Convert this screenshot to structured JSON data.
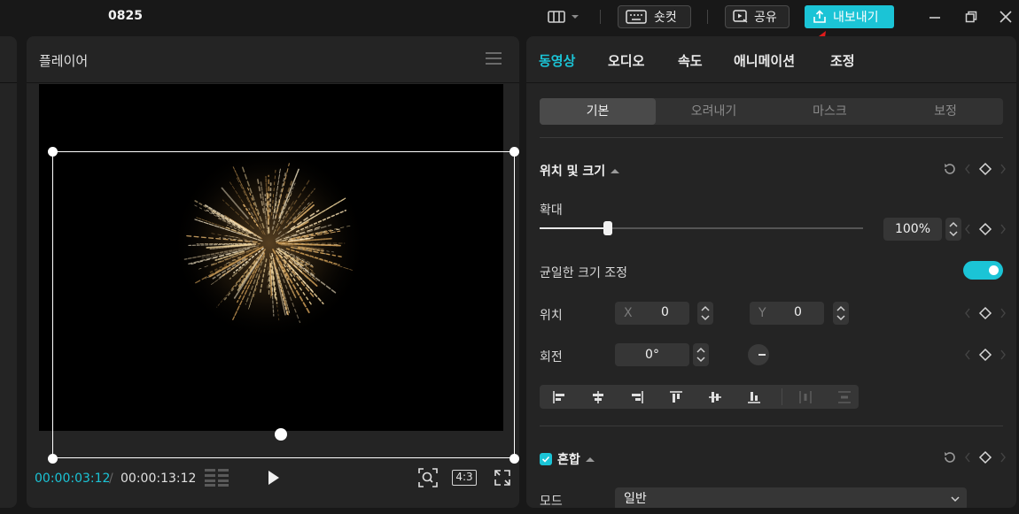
{
  "titlebar": {
    "project_name": "0825",
    "shortcut_label": "숏컷",
    "share_label": "공유",
    "export_label": "내보내기",
    "accent_color": "#1bc4d6"
  },
  "player": {
    "title": "플레이어",
    "current_time": "00:00:03:12",
    "separator": "/",
    "total_time": "00:00:13:12",
    "ratio_label": "4:3"
  },
  "inspector": {
    "tabs": [
      {
        "label": "동영상",
        "active": true
      },
      {
        "label": "오디오",
        "active": false
      },
      {
        "label": "속도",
        "active": false
      },
      {
        "label": "애니메이션",
        "active": false
      },
      {
        "label": "조정",
        "active": false
      }
    ],
    "subtabs": [
      {
        "label": "기본",
        "active": true
      },
      {
        "label": "오려내기",
        "active": false
      },
      {
        "label": "마스크",
        "active": false
      },
      {
        "label": "보정",
        "active": false
      }
    ],
    "position_size": {
      "title": "위치 및 크기",
      "scale_label": "확대",
      "scale_value": "100%",
      "scale_slider_fraction": 0.21,
      "uniform_scale_label": "균일한 크기 조정",
      "uniform_scale_on": true,
      "position_label": "위치",
      "x_label": "X",
      "x_value": "0",
      "y_label": "Y",
      "y_value": "0",
      "rotation_label": "회전",
      "rotation_value": "0°"
    },
    "blend": {
      "title": "혼합",
      "checked": true,
      "mode_label": "모드",
      "mode_value": "일반"
    }
  },
  "icons": [
    "layout-icon",
    "keyboard-icon",
    "share-video-icon",
    "upload-icon",
    "minimize-icon",
    "restore-icon",
    "close-icon",
    "menu-icon",
    "grid-icon",
    "play-icon",
    "zoom-fit-icon",
    "fullscreen-icon",
    "reset-icon",
    "keyframe-diamond-icon",
    "align-left-icon",
    "align-center-h-icon",
    "align-right-icon",
    "align-top-icon",
    "align-center-v-icon",
    "align-bottom-icon",
    "distribute-h-icon",
    "distribute-v-icon",
    "checkbox-icon",
    "chevron-down-icon"
  ]
}
